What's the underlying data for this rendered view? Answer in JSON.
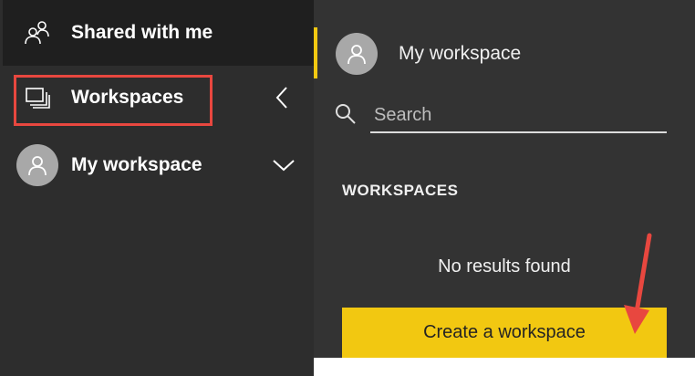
{
  "nav": {
    "items": [
      {
        "label": "Shared with me",
        "icon": "shared-people-icon"
      },
      {
        "label": "Workspaces",
        "icon": "workspaces-icon"
      },
      {
        "label": "My workspace",
        "icon": "avatar-icon"
      }
    ]
  },
  "panel": {
    "workspace_title": "My workspace",
    "search": {
      "placeholder": "Search",
      "value": ""
    },
    "section_label": "WORKSPACES",
    "empty_message": "No results found",
    "create_button": "Create a workspace"
  },
  "colors": {
    "nav_bg": "#2d2d2d",
    "panel_bg": "#333333",
    "accent": "#f2c811",
    "highlight": "#e8473f"
  }
}
